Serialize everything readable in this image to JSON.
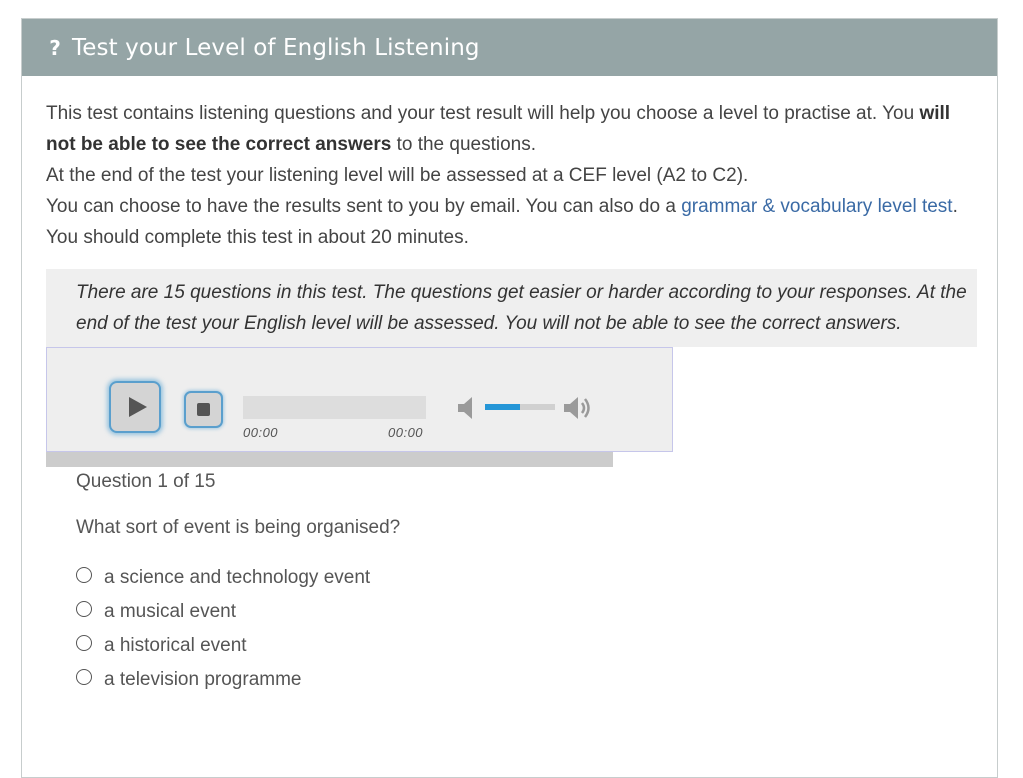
{
  "header": {
    "icon": "question-mark-icon",
    "icon_glyph": "?",
    "title": "Test your Level of English Listening"
  },
  "intro": {
    "p1_before": "This test contains listening questions and your test result will help you choose a level to practise at. You ",
    "p1_bold": "will not be able to see the correct answers",
    "p1_after": " to the questions.",
    "p2": "At the end of the test your listening level will be assessed at a CEF level (A2 to C2).",
    "p3_before": "You can choose to have the results sent to you by email. You can also do a ",
    "p3_link": "grammar & vocabulary level test",
    "p3_after": ".",
    "p4": "You should complete this test in about 20 minutes."
  },
  "notice": {
    "text": "There are 15 questions in this test. The questions get easier or harder according to your responses. At the end of the test your English level will be assessed. You will not be able to see the correct answers."
  },
  "player": {
    "play_icon": "play-icon",
    "stop_icon": "stop-icon",
    "mute_icon": "volume-mute-icon",
    "max_icon": "volume-max-icon",
    "current_time": "00:00",
    "total_time": "00:00",
    "volume_level": 0.5,
    "progress": 0
  },
  "question": {
    "counter": "Question 1 of 15",
    "text": "What sort of event is being organised?",
    "options": [
      "a science and technology event",
      "a musical event",
      "a historical event",
      "a television programme"
    ]
  },
  "colors": {
    "header_bg": "#95a5a6",
    "link": "#3a6aa5",
    "volume_fill": "#2596d7",
    "button_glow": "#5a9fcd"
  }
}
